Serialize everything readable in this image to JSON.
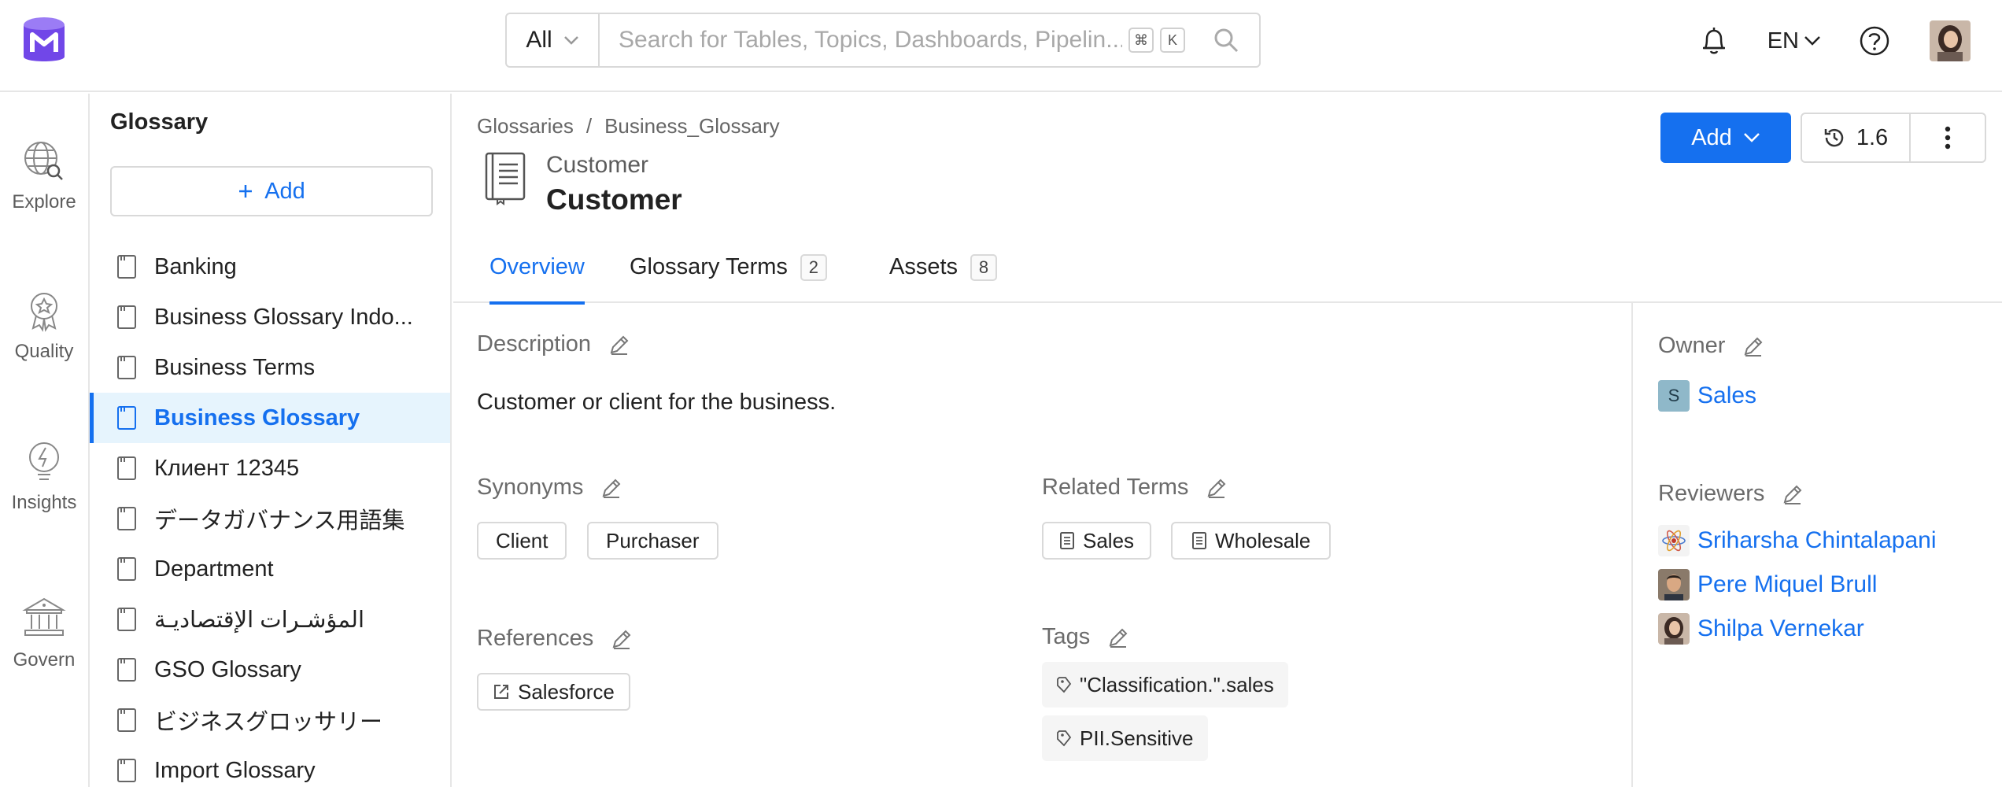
{
  "search": {
    "scope": "All",
    "placeholder": "Search for Tables, Topics, Dashboards, Pipelin...",
    "kbd_cmd": "⌘",
    "kbd_k": "K"
  },
  "header": {
    "language": "EN"
  },
  "rail": {
    "items": [
      {
        "label": "Explore"
      },
      {
        "label": "Quality"
      },
      {
        "label": "Insights"
      },
      {
        "label": "Govern"
      }
    ]
  },
  "glossary_panel": {
    "title": "Glossary",
    "add_label": "Add",
    "items": [
      {
        "label": "Banking"
      },
      {
        "label": "Business Glossary Indo..."
      },
      {
        "label": "Business Terms"
      },
      {
        "label": "Business Glossary"
      },
      {
        "label": "Клиент 12345"
      },
      {
        "label": "データガバナンス用語集"
      },
      {
        "label": "Department"
      },
      {
        "label": "المؤشـرات الإقتصاديـة"
      },
      {
        "label": "GSO Glossary"
      },
      {
        "label": "ビジネスグロッサリー"
      },
      {
        "label": "Import Glossary"
      }
    ]
  },
  "breadcrumb": {
    "root": "Glossaries",
    "separator": "/",
    "current": "Business_Glossary"
  },
  "entity": {
    "display_name": "Customer",
    "name": "Customer"
  },
  "actions": {
    "add_label": "Add",
    "version": "1.6"
  },
  "tabs": [
    {
      "label": "Overview"
    },
    {
      "label": "Glossary Terms",
      "count": "2"
    },
    {
      "label": "Assets",
      "count": "8"
    }
  ],
  "overview": {
    "description_label": "Description",
    "description": "Customer or client for the business.",
    "synonyms_label": "Synonyms",
    "synonyms": [
      "Client",
      "Purchaser"
    ],
    "related_terms_label": "Related Terms",
    "related_terms": [
      "Sales",
      "Wholesale"
    ],
    "references_label": "References",
    "references": [
      "Salesforce"
    ],
    "tags_label": "Tags",
    "tags": [
      "\"Classification.\".sales",
      "PII.Sensitive"
    ]
  },
  "side": {
    "owner_label": "Owner",
    "owner": {
      "initial": "S",
      "name": "Sales"
    },
    "reviewers_label": "Reviewers",
    "reviewers": [
      {
        "name": "Sriharsha Chintalapani"
      },
      {
        "name": "Pere Miquel Brull"
      },
      {
        "name": "Shilpa Vernekar"
      }
    ]
  },
  "colors": {
    "accent": "#1570ef",
    "active_bg": "#e6f4fd",
    "logo": "#7147e8"
  }
}
